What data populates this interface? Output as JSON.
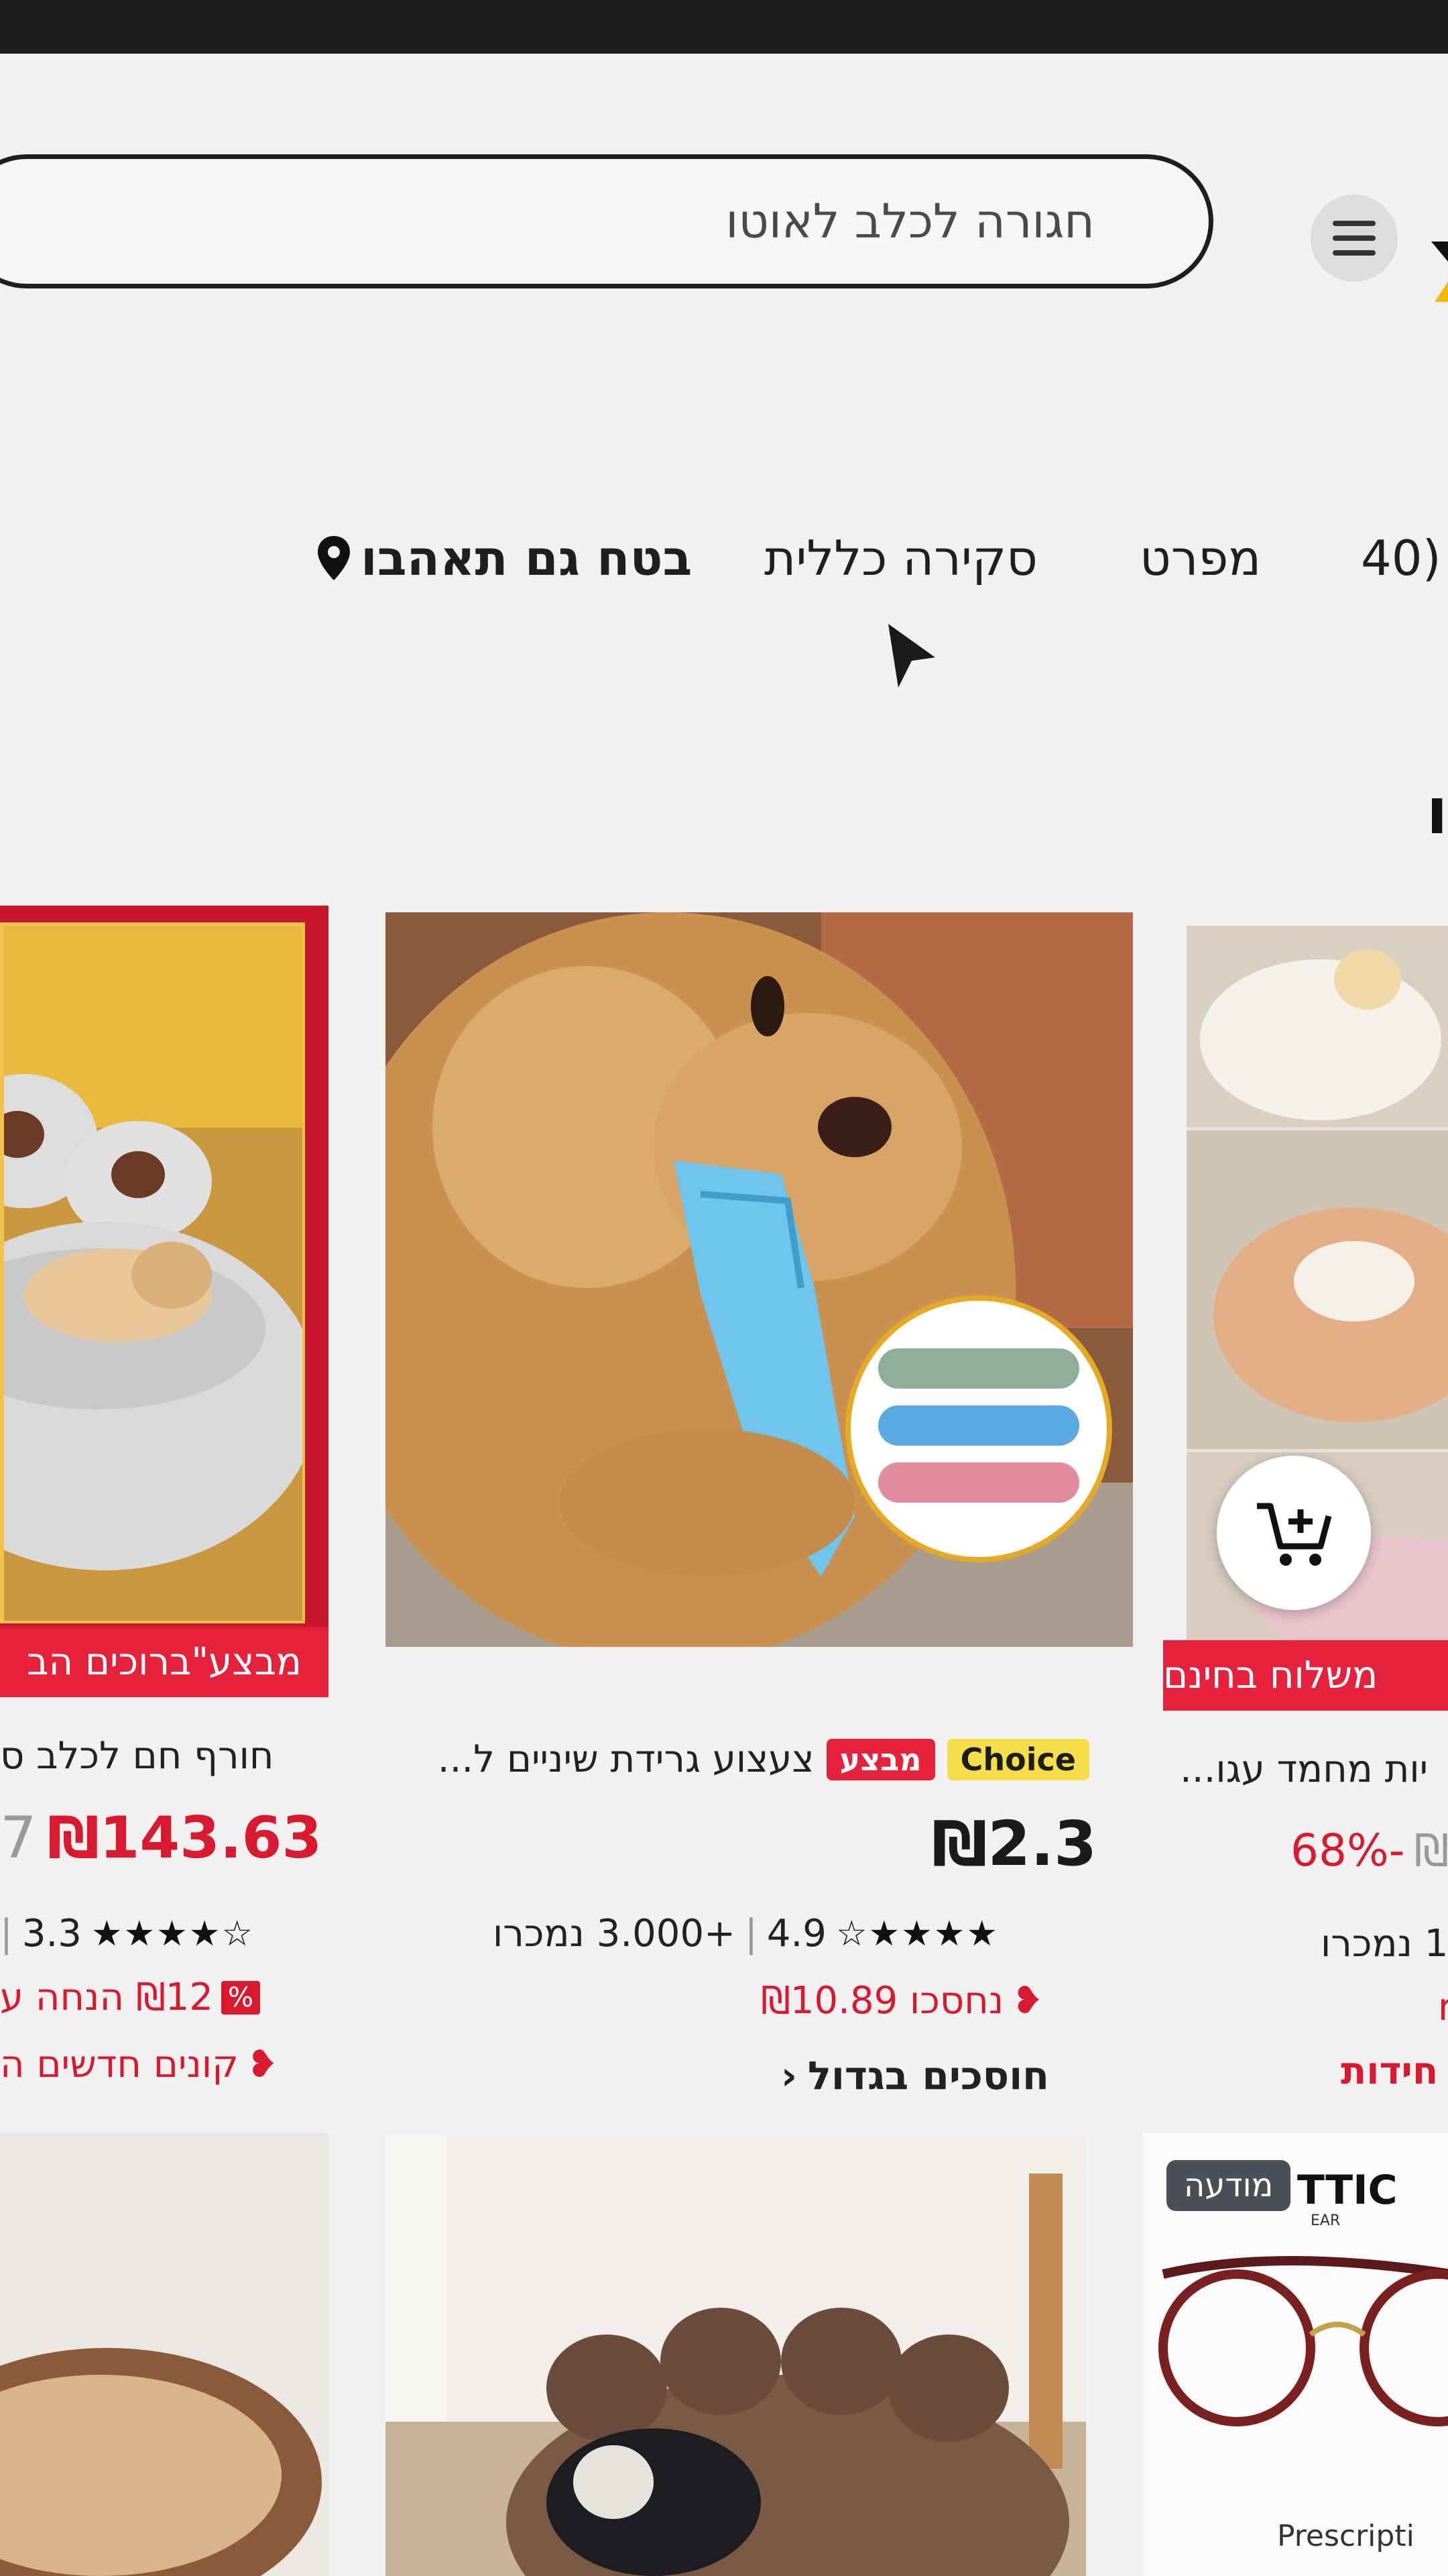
{
  "search": {
    "placeholder": "חגורה לכלב לאוטו"
  },
  "tabs": [
    {
      "label": "(40"
    },
    {
      "label": "מפרט"
    },
    {
      "label": "סקירה כללית"
    },
    {
      "label": "בטח גם תאהבו"
    }
  ],
  "section_heading": "ו",
  "products": [
    {
      "banner": "מבצע\"ברוכים הב",
      "title": "חורף חם לכלב ס",
      "price": "₪143.63",
      "old_price": "7",
      "rating": "3.3",
      "sale_line": "₪12 הנחה ע",
      "sale_icon": "%",
      "promo_line": "קונים חדשים ה"
    },
    {
      "badge_choice": "Choice",
      "badge_deal": "מבצע",
      "title": "צעצוע גרידת שיניים ל...",
      "price": "₪2.3",
      "rating": "4.9",
      "sold": "+3.000 נמכרו",
      "saved_line": "נחסכו ₪10.89",
      "link": "חוסכים בגדול"
    },
    {
      "banner": "משלוח בחינם",
      "title": "יות מחמד עגו...",
      "price": "₪",
      "discount": "-68%",
      "sold": "1 נמכרו",
      "cut_text": "r",
      "promo_line": "חידות"
    }
  ],
  "ad": {
    "badge": "מודעה",
    "brand": "TTIC",
    "brand_sub": "EAR",
    "caption": "Prescripti"
  },
  "colors": {
    "accent": "#e6213b",
    "choice_yellow": "#f6dd4a",
    "background": "#f1f1f1"
  }
}
